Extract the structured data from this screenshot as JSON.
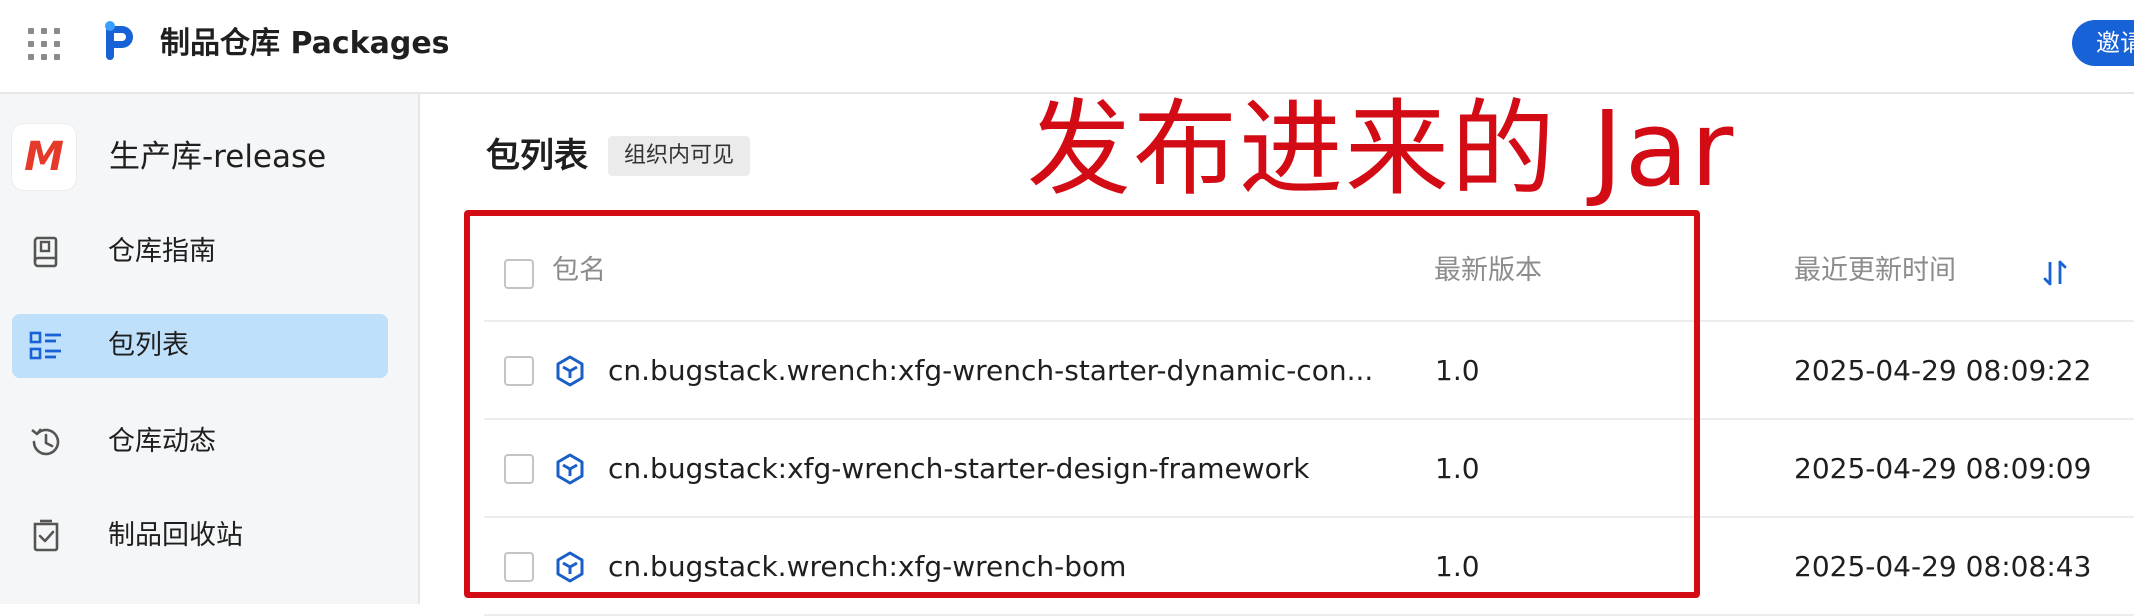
{
  "header": {
    "app_title": "制品仓库 Packages",
    "invite_label": "邀请"
  },
  "sidebar": {
    "repo": {
      "avatar_letter": "M",
      "name": "生产库-release"
    },
    "items": [
      {
        "label": "仓库指南",
        "icon": "book-icon",
        "active": false
      },
      {
        "label": "包列表",
        "icon": "list-icon",
        "active": true
      },
      {
        "label": "仓库动态",
        "icon": "history-icon",
        "active": false
      },
      {
        "label": "制品回收站",
        "icon": "trash-icon",
        "active": false
      }
    ]
  },
  "main": {
    "title": "包列表",
    "visibility_badge": "组织内可见",
    "annotation": "发布进来的 Jar",
    "table": {
      "columns": {
        "name": "包名",
        "version": "最新版本",
        "updated": "最近更新时间"
      },
      "rows": [
        {
          "name": "cn.bugstack.wrench:xfg-wrench-starter-dynamic-con...",
          "version": "1.0",
          "updated": "2025-04-29 08:09:22"
        },
        {
          "name": "cn.bugstack:xfg-wrench-starter-design-framework",
          "version": "1.0",
          "updated": "2025-04-29 08:09:09"
        },
        {
          "name": "cn.bugstack.wrench:xfg-wrench-bom",
          "version": "1.0",
          "updated": "2025-04-29 08:08:43"
        }
      ]
    }
  },
  "colors": {
    "accent": "#1762d6",
    "active_nav": "#bfe0fb",
    "annotation": "#d20b14",
    "package_icon": "#1a5fc8"
  }
}
